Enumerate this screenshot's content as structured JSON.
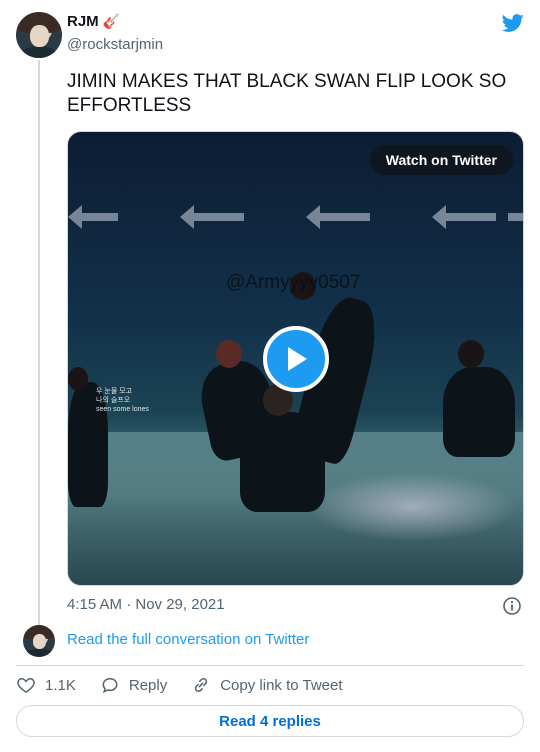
{
  "author": {
    "name": "RJM",
    "emoji": "🎸",
    "handle": "@rockstarjmin"
  },
  "tweet": {
    "text": "JIMIN MAKES THAT BLACK SWAN FLIP LOOK SO EFFORTLESS",
    "timestamp": "4:15 AM · Nov 29, 2021"
  },
  "media": {
    "watch_label": "Watch on Twitter",
    "watermark": "@Armyyyy0507",
    "caption_text": "우 눈물 모고\n나의 슬프오\nseen some lones"
  },
  "conversation": {
    "link_text": "Read the full conversation on Twitter"
  },
  "actions": {
    "like_count": "1.1K",
    "reply_label": "Reply",
    "copy_label": "Copy link to Tweet"
  },
  "replies": {
    "label": "Read 4 replies"
  },
  "colors": {
    "accent": "#1d9bf0",
    "link": "#006fd6",
    "muted": "#536471",
    "border": "#cfd9de"
  }
}
